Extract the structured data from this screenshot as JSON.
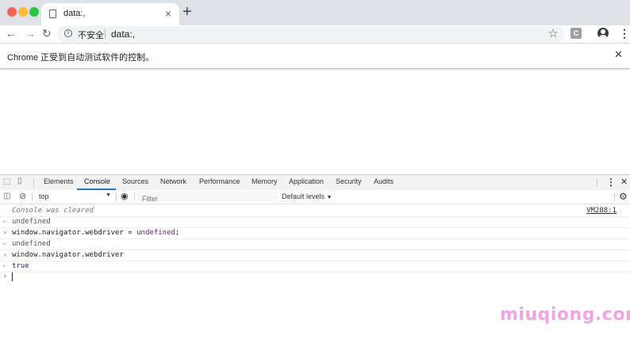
{
  "colors": {
    "traffic_red": "#ff5f57",
    "traffic_yellow": "#febc2e",
    "traffic_green": "#28c840",
    "devtools_accent": "#1a73e8",
    "watermark": "#f0a6e2"
  },
  "browser": {
    "tab_title": "data:,",
    "new_tab_icon": "plus-icon",
    "security_label": "不安全",
    "url": "data:,",
    "extension_label": "C"
  },
  "infobar": {
    "message": "Chrome 正受到自动测试软件的控制。"
  },
  "devtools": {
    "tabs": [
      "Elements",
      "Console",
      "Sources",
      "Network",
      "Performance",
      "Memory",
      "Application",
      "Security",
      "Audits"
    ],
    "active_tab": "Console",
    "context": "top",
    "filter_placeholder": "Filter",
    "levels": "Default levels"
  },
  "console": {
    "cleared_message": "Console was cleared",
    "cleared_source": "VM288:1",
    "lines": [
      {
        "type": "output",
        "text": "undefined"
      },
      {
        "type": "input",
        "text": "window.navigator.webdriver = undefined;"
      },
      {
        "type": "output",
        "text": "undefined"
      },
      {
        "type": "input",
        "text": "window.navigator.webdriver"
      },
      {
        "type": "output",
        "text": "true"
      }
    ]
  },
  "watermark": "miuqiong.com"
}
